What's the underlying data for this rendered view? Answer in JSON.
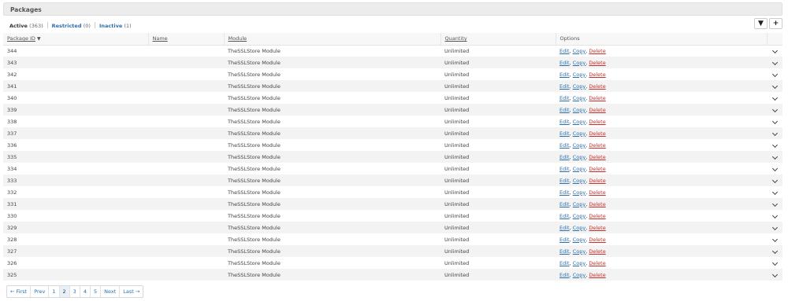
{
  "panel": {
    "title": "Packages"
  },
  "filters": [
    {
      "label": "Active",
      "count": "(363)",
      "active": true
    },
    {
      "label": "Restricted",
      "count": "(0)",
      "active": false
    },
    {
      "label": "Inactive",
      "count": "(1)",
      "active": false
    }
  ],
  "toolbar": {
    "filter_icon": "filter-icon",
    "add_icon": "plus-icon",
    "filter_glyph": "▼",
    "add_glyph": "+"
  },
  "table": {
    "columns": [
      "Package ID",
      "Name",
      "Module",
      "Quantity",
      "Options"
    ],
    "sort_indicator": "▼",
    "rows": [
      {
        "id": "344",
        "name": "",
        "module": "TheSSLStore Module",
        "quantity": "Unlimited"
      },
      {
        "id": "343",
        "name": "",
        "module": "TheSSLStore Module",
        "quantity": "Unlimited"
      },
      {
        "id": "342",
        "name": "",
        "module": "TheSSLStore Module",
        "quantity": "Unlimited"
      },
      {
        "id": "341",
        "name": "",
        "module": "TheSSLStore Module",
        "quantity": "Unlimited"
      },
      {
        "id": "340",
        "name": "",
        "module": "TheSSLStore Module",
        "quantity": "Unlimited"
      },
      {
        "id": "339",
        "name": "",
        "module": "TheSSLStore Module",
        "quantity": "Unlimited"
      },
      {
        "id": "338",
        "name": "",
        "module": "TheSSLStore Module",
        "quantity": "Unlimited"
      },
      {
        "id": "337",
        "name": "",
        "module": "TheSSLStore Module",
        "quantity": "Unlimited"
      },
      {
        "id": "336",
        "name": "",
        "module": "TheSSLStore Module",
        "quantity": "Unlimited"
      },
      {
        "id": "335",
        "name": "",
        "module": "TheSSLStore Module",
        "quantity": "Unlimited"
      },
      {
        "id": "334",
        "name": "",
        "module": "TheSSLStore Module",
        "quantity": "Unlimited"
      },
      {
        "id": "333",
        "name": "",
        "module": "TheSSLStore Module",
        "quantity": "Unlimited"
      },
      {
        "id": "332",
        "name": "",
        "module": "TheSSLStore Module",
        "quantity": "Unlimited"
      },
      {
        "id": "331",
        "name": "",
        "module": "TheSSLStore Module",
        "quantity": "Unlimited"
      },
      {
        "id": "330",
        "name": "",
        "module": "TheSSLStore Module",
        "quantity": "Unlimited"
      },
      {
        "id": "329",
        "name": "",
        "module": "TheSSLStore Module",
        "quantity": "Unlimited"
      },
      {
        "id": "328",
        "name": "",
        "module": "TheSSLStore Module",
        "quantity": "Unlimited"
      },
      {
        "id": "327",
        "name": "",
        "module": "TheSSLStore Module",
        "quantity": "Unlimited"
      },
      {
        "id": "326",
        "name": "",
        "module": "TheSSLStore Module",
        "quantity": "Unlimited"
      },
      {
        "id": "325",
        "name": "",
        "module": "TheSSLStore Module",
        "quantity": "Unlimited"
      }
    ],
    "options": {
      "edit": "Edit",
      "copy": "Copy",
      "delete": "Delete",
      "sep": ", "
    }
  },
  "pagination": {
    "items": [
      {
        "label": "← First",
        "current": false
      },
      {
        "label": "Prev",
        "current": false
      },
      {
        "label": "1",
        "current": false
      },
      {
        "label": "2",
        "current": true
      },
      {
        "label": "3",
        "current": false
      },
      {
        "label": "4",
        "current": false
      },
      {
        "label": "5",
        "current": false
      },
      {
        "label": "Next",
        "current": false
      },
      {
        "label": "Last →",
        "current": false
      }
    ]
  },
  "colors": {
    "link": "#2a6fb0",
    "delete": "#c9302c",
    "header_bg": "#ececec",
    "stripe": "#f3f3f3"
  }
}
